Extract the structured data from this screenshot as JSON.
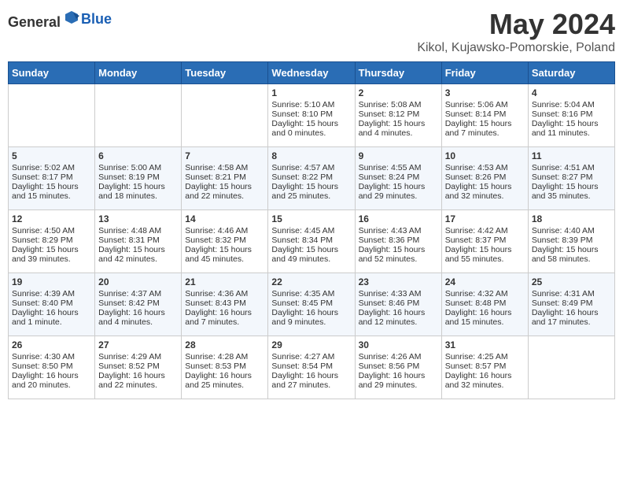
{
  "header": {
    "logo_general": "General",
    "logo_blue": "Blue",
    "month_year": "May 2024",
    "location": "Kikol, Kujawsko-Pomorskie, Poland"
  },
  "days_of_week": [
    "Sunday",
    "Monday",
    "Tuesday",
    "Wednesday",
    "Thursday",
    "Friday",
    "Saturday"
  ],
  "weeks": [
    [
      {
        "day": "",
        "sunrise": "",
        "sunset": "",
        "daylight": ""
      },
      {
        "day": "",
        "sunrise": "",
        "sunset": "",
        "daylight": ""
      },
      {
        "day": "",
        "sunrise": "",
        "sunset": "",
        "daylight": ""
      },
      {
        "day": "1",
        "sunrise": "Sunrise: 5:10 AM",
        "sunset": "Sunset: 8:10 PM",
        "daylight": "Daylight: 15 hours and 0 minutes."
      },
      {
        "day": "2",
        "sunrise": "Sunrise: 5:08 AM",
        "sunset": "Sunset: 8:12 PM",
        "daylight": "Daylight: 15 hours and 4 minutes."
      },
      {
        "day": "3",
        "sunrise": "Sunrise: 5:06 AM",
        "sunset": "Sunset: 8:14 PM",
        "daylight": "Daylight: 15 hours and 7 minutes."
      },
      {
        "day": "4",
        "sunrise": "Sunrise: 5:04 AM",
        "sunset": "Sunset: 8:16 PM",
        "daylight": "Daylight: 15 hours and 11 minutes."
      }
    ],
    [
      {
        "day": "5",
        "sunrise": "Sunrise: 5:02 AM",
        "sunset": "Sunset: 8:17 PM",
        "daylight": "Daylight: 15 hours and 15 minutes."
      },
      {
        "day": "6",
        "sunrise": "Sunrise: 5:00 AM",
        "sunset": "Sunset: 8:19 PM",
        "daylight": "Daylight: 15 hours and 18 minutes."
      },
      {
        "day": "7",
        "sunrise": "Sunrise: 4:58 AM",
        "sunset": "Sunset: 8:21 PM",
        "daylight": "Daylight: 15 hours and 22 minutes."
      },
      {
        "day": "8",
        "sunrise": "Sunrise: 4:57 AM",
        "sunset": "Sunset: 8:22 PM",
        "daylight": "Daylight: 15 hours and 25 minutes."
      },
      {
        "day": "9",
        "sunrise": "Sunrise: 4:55 AM",
        "sunset": "Sunset: 8:24 PM",
        "daylight": "Daylight: 15 hours and 29 minutes."
      },
      {
        "day": "10",
        "sunrise": "Sunrise: 4:53 AM",
        "sunset": "Sunset: 8:26 PM",
        "daylight": "Daylight: 15 hours and 32 minutes."
      },
      {
        "day": "11",
        "sunrise": "Sunrise: 4:51 AM",
        "sunset": "Sunset: 8:27 PM",
        "daylight": "Daylight: 15 hours and 35 minutes."
      }
    ],
    [
      {
        "day": "12",
        "sunrise": "Sunrise: 4:50 AM",
        "sunset": "Sunset: 8:29 PM",
        "daylight": "Daylight: 15 hours and 39 minutes."
      },
      {
        "day": "13",
        "sunrise": "Sunrise: 4:48 AM",
        "sunset": "Sunset: 8:31 PM",
        "daylight": "Daylight: 15 hours and 42 minutes."
      },
      {
        "day": "14",
        "sunrise": "Sunrise: 4:46 AM",
        "sunset": "Sunset: 8:32 PM",
        "daylight": "Daylight: 15 hours and 45 minutes."
      },
      {
        "day": "15",
        "sunrise": "Sunrise: 4:45 AM",
        "sunset": "Sunset: 8:34 PM",
        "daylight": "Daylight: 15 hours and 49 minutes."
      },
      {
        "day": "16",
        "sunrise": "Sunrise: 4:43 AM",
        "sunset": "Sunset: 8:36 PM",
        "daylight": "Daylight: 15 hours and 52 minutes."
      },
      {
        "day": "17",
        "sunrise": "Sunrise: 4:42 AM",
        "sunset": "Sunset: 8:37 PM",
        "daylight": "Daylight: 15 hours and 55 minutes."
      },
      {
        "day": "18",
        "sunrise": "Sunrise: 4:40 AM",
        "sunset": "Sunset: 8:39 PM",
        "daylight": "Daylight: 15 hours and 58 minutes."
      }
    ],
    [
      {
        "day": "19",
        "sunrise": "Sunrise: 4:39 AM",
        "sunset": "Sunset: 8:40 PM",
        "daylight": "Daylight: 16 hours and 1 minute."
      },
      {
        "day": "20",
        "sunrise": "Sunrise: 4:37 AM",
        "sunset": "Sunset: 8:42 PM",
        "daylight": "Daylight: 16 hours and 4 minutes."
      },
      {
        "day": "21",
        "sunrise": "Sunrise: 4:36 AM",
        "sunset": "Sunset: 8:43 PM",
        "daylight": "Daylight: 16 hours and 7 minutes."
      },
      {
        "day": "22",
        "sunrise": "Sunrise: 4:35 AM",
        "sunset": "Sunset: 8:45 PM",
        "daylight": "Daylight: 16 hours and 9 minutes."
      },
      {
        "day": "23",
        "sunrise": "Sunrise: 4:33 AM",
        "sunset": "Sunset: 8:46 PM",
        "daylight": "Daylight: 16 hours and 12 minutes."
      },
      {
        "day": "24",
        "sunrise": "Sunrise: 4:32 AM",
        "sunset": "Sunset: 8:48 PM",
        "daylight": "Daylight: 16 hours and 15 minutes."
      },
      {
        "day": "25",
        "sunrise": "Sunrise: 4:31 AM",
        "sunset": "Sunset: 8:49 PM",
        "daylight": "Daylight: 16 hours and 17 minutes."
      }
    ],
    [
      {
        "day": "26",
        "sunrise": "Sunrise: 4:30 AM",
        "sunset": "Sunset: 8:50 PM",
        "daylight": "Daylight: 16 hours and 20 minutes."
      },
      {
        "day": "27",
        "sunrise": "Sunrise: 4:29 AM",
        "sunset": "Sunset: 8:52 PM",
        "daylight": "Daylight: 16 hours and 22 minutes."
      },
      {
        "day": "28",
        "sunrise": "Sunrise: 4:28 AM",
        "sunset": "Sunset: 8:53 PM",
        "daylight": "Daylight: 16 hours and 25 minutes."
      },
      {
        "day": "29",
        "sunrise": "Sunrise: 4:27 AM",
        "sunset": "Sunset: 8:54 PM",
        "daylight": "Daylight: 16 hours and 27 minutes."
      },
      {
        "day": "30",
        "sunrise": "Sunrise: 4:26 AM",
        "sunset": "Sunset: 8:56 PM",
        "daylight": "Daylight: 16 hours and 29 minutes."
      },
      {
        "day": "31",
        "sunrise": "Sunrise: 4:25 AM",
        "sunset": "Sunset: 8:57 PM",
        "daylight": "Daylight: 16 hours and 32 minutes."
      },
      {
        "day": "",
        "sunrise": "",
        "sunset": "",
        "daylight": ""
      }
    ]
  ]
}
